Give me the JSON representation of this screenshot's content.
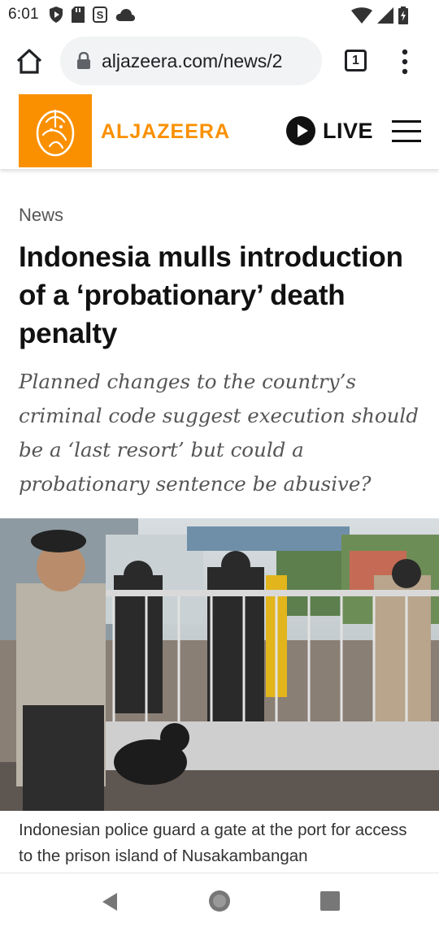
{
  "status_bar": {
    "time": "6:01",
    "left_icons": [
      "shield-play-icon",
      "sd-card-icon",
      "s-app-icon",
      "cloud-icon"
    ],
    "right_icons": [
      "wifi-icon",
      "signal-icon",
      "battery-icon"
    ]
  },
  "browser": {
    "url": "aljazeera.com/news/2",
    "tab_count": "1"
  },
  "site": {
    "logo_text": "ALJAZEERA",
    "live_label": "LIVE",
    "brand_color": "#fa9000"
  },
  "article": {
    "category": "News",
    "headline": "Indonesia mulls introduction of a ‘probationary’ death penalty",
    "standfirst": "Planned changes to the country’s criminal code suggest execution should be a ‘last resort’ but could a probationary sentence be abusive?",
    "caption": "Indonesian police guard a gate at the port for access to the prison island of Nusakambangan"
  },
  "nav": {
    "icons": [
      "back-icon",
      "home-circle-icon",
      "recent-apps-icon"
    ]
  }
}
